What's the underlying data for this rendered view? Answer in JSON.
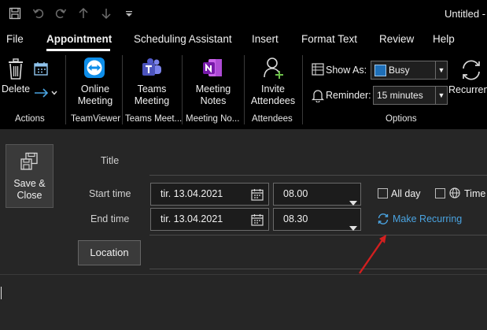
{
  "window": {
    "title": "Untitled -"
  },
  "tabs": [
    {
      "label": "File"
    },
    {
      "label": "Appointment"
    },
    {
      "label": "Scheduling Assistant"
    },
    {
      "label": "Insert"
    },
    {
      "label": "Format Text"
    },
    {
      "label": "Review"
    },
    {
      "label": "Help"
    }
  ],
  "ribbon": {
    "delete_label": "Delete",
    "online_meeting": {
      "line1": "Online",
      "line2": "Meeting"
    },
    "teams_meeting": {
      "line1": "Teams",
      "line2": "Meeting"
    },
    "meeting_notes": {
      "line1": "Meeting",
      "line2": "Notes"
    },
    "invite_attendees": {
      "line1": "Invite",
      "line2": "Attendees"
    },
    "show_as_label": "Show As:",
    "show_as_value": "Busy",
    "reminder_label": "Reminder:",
    "reminder_value": "15 minutes",
    "recurrence_label": "Recurrence",
    "groups": {
      "actions": "Actions",
      "teamviewer": "TeamViewer",
      "teams": "Teams Meet...",
      "notes": "Meeting No...",
      "attendees": "Attendees",
      "options": "Options"
    }
  },
  "form": {
    "save_close": {
      "line1": "Save &",
      "line2": "Close"
    },
    "title_label": "Title",
    "start_label": "Start time",
    "end_label": "End time",
    "start_date": "tir. 13.04.2021",
    "start_time": "08.00",
    "end_date": "tir. 13.04.2021",
    "end_time": "08.30",
    "all_day": "All day",
    "time_zones": "Time",
    "make_recurring": "Make Recurring",
    "location": "Location"
  },
  "colors": {
    "accent_link": "#4aa3e0",
    "busy_swatch": "#1e6fb8",
    "arrow": "#d21f1f"
  }
}
